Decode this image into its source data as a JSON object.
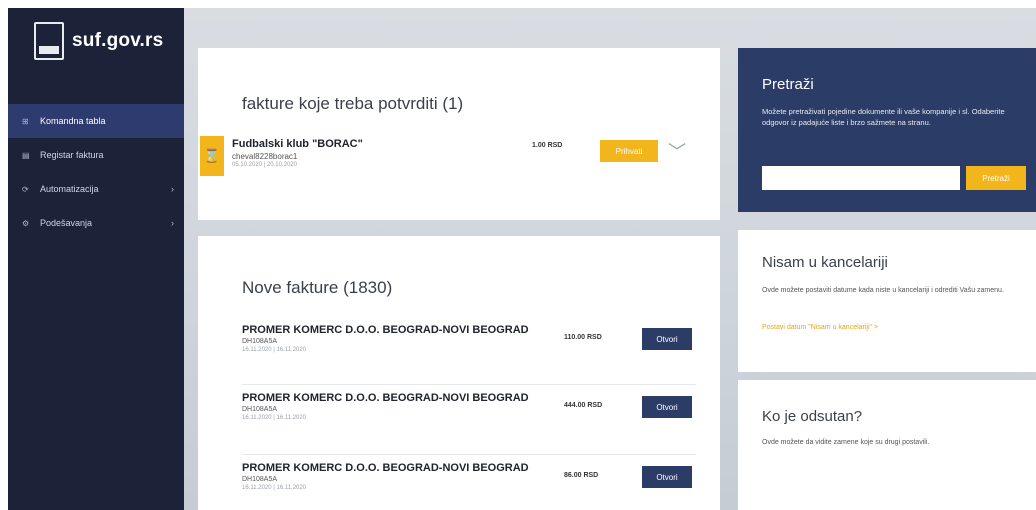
{
  "sidebar": {
    "logo_text": "suf.gov.rs",
    "items": [
      {
        "icon": "home-icon",
        "glyph": "⊞",
        "label": "Komandna tabla",
        "chevron": ""
      },
      {
        "icon": "list-icon",
        "glyph": "▤",
        "label": "Registar faktura",
        "chevron": ""
      },
      {
        "icon": "automation-icon",
        "glyph": "⟳",
        "label": "Automatizacija",
        "chevron": "›"
      },
      {
        "icon": "settings-icon",
        "glyph": "⚙",
        "label": "Podešavanja",
        "chevron": "›"
      }
    ]
  },
  "confirm": {
    "title": "fakture koje treba potvrditi (1)",
    "item": {
      "company": "Fudbalski klub \"BORAC\"",
      "code": "cheval8228borac1",
      "date": "05.10.2020 | 20.10.2020",
      "amount": "1.00 RSD",
      "accept_label": "Prihvati"
    }
  },
  "new_invoices": {
    "title": "Nove fakture (1830)",
    "open_label": "Otvori",
    "items": [
      {
        "company": "PROMER KOMERC D.O.O. BEOGRAD-NOVI BEOGRAD",
        "code": "DH108A5A",
        "date": "16.11.2020 | 16.11.2020",
        "amount": "110.00 RSD"
      },
      {
        "company": "PROMER KOMERC D.O.O. BEOGRAD-NOVI BEOGRAD",
        "code": "DH108A5A",
        "date": "16.11.2020 | 16.11.2020",
        "amount": "444.00 RSD"
      },
      {
        "company": "PROMER KOMERC D.O.O. BEOGRAD-NOVI BEOGRAD",
        "code": "DH108A5A",
        "date": "16.11.2020 | 16.11.2020",
        "amount": "86.00 RSD"
      }
    ]
  },
  "search": {
    "title": "Pretraži",
    "description": "Možete pretraživati pojedine dokumente ili vaše kompanije i sl. Odaberite odgovor iz padajuće liste i brzo sažmete na stranu.",
    "placeholder": "",
    "button_label": "Pretraži"
  },
  "office": {
    "title": "Nisam u kancelariji",
    "description": "Ovde možete postaviti datume kada niste u kancelariji i odrediti Vašu zamenu.",
    "link": "Postavi datum \"Nisam u kancelariji\" >"
  },
  "absent": {
    "title": "Ko je odsutan?",
    "description": "Ovde možete da vidite zamene koje su drugi postavili."
  },
  "colors": {
    "sidebar": "#1c2238",
    "accent": "#f2b51c",
    "primary": "#2b3d66"
  }
}
